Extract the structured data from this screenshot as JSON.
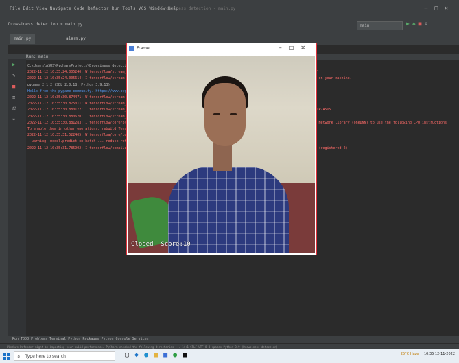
{
  "ide": {
    "menu": "File  Edit  View  Navigate  Code  Refactor  Run  Tools  VCS  Window  Help",
    "project_title": "Drowsiness detection - main.py",
    "breadcrumb": "Drowsiness detection  >  main.py",
    "run_config": "main",
    "tabs": [
      {
        "label": "main.py"
      },
      {
        "label": "alarm.py"
      }
    ],
    "run_header": "Run:   main",
    "console_lines": [
      {
        "text": "C:\\Users\\ASUS\\PycharmProjects\\Drowsiness detection\\venv\\Scripts\\python.exe C:/Users/ASUS/PycharmProjects/Drowsiness detection/main.py",
        "kind": "white"
      },
      {
        "text": "2022-11-12 10:35:24.005240: W tensorflow/stream_executor/platform/default/dso_loader.cc:64] Could not load dynamic library 'cudart64_110.dll'",
        "kind": "red"
      },
      {
        "text": "2022-11-12 10:35:24.005614: I tensorflow/stream_executor/cuda/cudart_stub.cc:29] Ignore above cudart dlerror if you do not have a GPU set up on your machine.",
        "kind": "red"
      },
      {
        "text": "pygame 2.1.2 (SDL 2.0.18, Python 3.9.13)",
        "kind": "white"
      },
      {
        "text": "Hello from the pygame community. https://www.pygame.org/contribute.html",
        "kind": "link"
      },
      {
        "text": "2022-11-12 10:35:30.874471: W tensorflow/stream_executor/platform/default/dso_loader.cc:64] Could not load dynamic library 'cuda.dll'",
        "kind": "red"
      },
      {
        "text": "2022-11-12 10:35:30.875011: W tensorflow/stream_executor/cuda/cuda_driver.cc:269] failed call to cuInit: UNKNOWN ERROR (303)",
        "kind": "red"
      },
      {
        "text": "2022-11-12 10:35:30.880172: I tensorflow/stream_executor/cuda/cuda_diagnostics.cc:169] retrieving CUDA diagnostic information for host: LAPTOP-ASUS",
        "kind": "red"
      },
      {
        "text": "2022-11-12 10:35:30.880620: I tensorflow/stream_executor/cuda/cuda_diagnostics.cc:176] hostname: LAPTOP-ASUS",
        "kind": "red"
      },
      {
        "text": "2022-11-12 10:35:30.881283: I tensorflow/core/platform/cpu_feature_guard.cc:151] This TensorFlow binary is optimized with oneAPI Deep Neural Network Library (oneDNN) to use the following CPU instructions",
        "kind": "red"
      },
      {
        "text": "To enable them in other operations, rebuild TensorFlow with the appropriate compiler flags.",
        "kind": "red"
      },
      {
        "text": "2022-11-12 10:35:31.522405: W tensorflow/core/common_runtime/...] 1 out of the last 1 calls to <function> triggered tf.function retracing.",
        "kind": "red"
      },
      {
        "text": "  warning: model.predict_on_batch ... reduce_retracing=True option",
        "kind": "red"
      },
      {
        "text": "2022-11-12 10:35:31.785902: I tensorflow/compiler/mlir/mlir_graph_optimization_pass.cc:185] None of the MLIR Optimization Passes are enabled (registered 2)",
        "kind": "red"
      }
    ],
    "bottom_tabs": "Run    TODO    Problems    Terminal    Python Packages    Python Console    Services",
    "status": "Windows Defender might be impacting your build performance. PyCharm checked the following directories ...   14:1   CRLF   UTF-8   4 spaces   Python 3.9 (Drowsiness detection)"
  },
  "frame_window": {
    "title": "Frame",
    "overlay_text": "Closed  Score:10"
  },
  "taskbar": {
    "search_placeholder": "Type here to search",
    "weather": "25°C Haze",
    "clock": "10:35 12-11-2022"
  }
}
